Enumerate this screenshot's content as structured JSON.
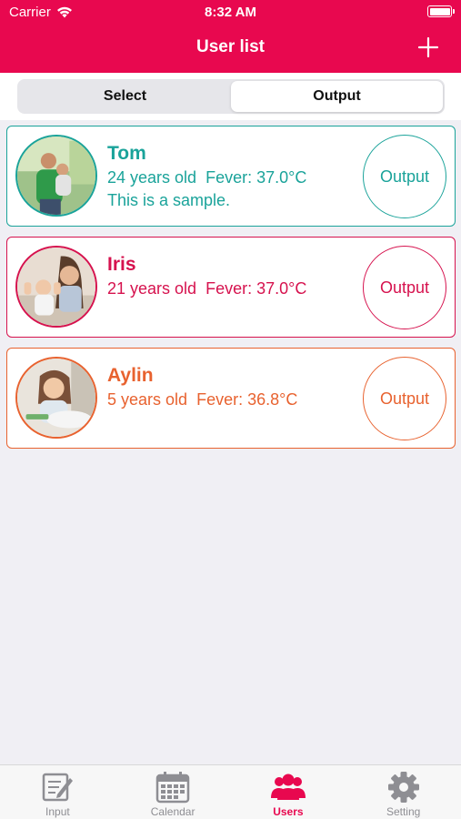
{
  "status": {
    "carrier": "Carrier",
    "time": "8:32 AM"
  },
  "nav": {
    "title": "User list"
  },
  "segments": [
    {
      "label": "Select",
      "selected": false
    },
    {
      "label": "Output",
      "selected": true
    }
  ],
  "users": [
    {
      "name": "Tom",
      "age": "24 years old",
      "fever": "Fever: 37.0°C",
      "note": "This is a sample.",
      "button": "Output",
      "color": "#1aa39a"
    },
    {
      "name": "Iris",
      "age": "21 years old",
      "fever": "Fever: 37.0°C",
      "note": "",
      "button": "Output",
      "color": "#d6124e"
    },
    {
      "name": "Aylin",
      "age": "5 years old",
      "fever": "Fever: 36.8°C",
      "note": "",
      "button": "Output",
      "color": "#e8622f"
    }
  ],
  "tabs": [
    {
      "label": "Input",
      "icon": "input-icon",
      "active": false
    },
    {
      "label": "Calendar",
      "icon": "calendar-icon",
      "active": false
    },
    {
      "label": "Users",
      "icon": "users-icon",
      "active": true
    },
    {
      "label": "Setting",
      "icon": "gear-icon",
      "active": false
    }
  ],
  "colors": {
    "brand": "#e8084f",
    "teal": "#1aa39a",
    "pink": "#d6124e",
    "orange": "#e8622f"
  }
}
